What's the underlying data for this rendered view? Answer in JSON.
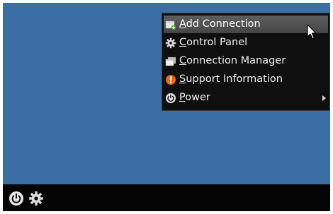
{
  "desktop": {
    "background_color": "#3c6ea6"
  },
  "menu": {
    "items": [
      {
        "label_first": "A",
        "label_rest": "dd Connection",
        "icon": "add-connection-icon",
        "selected": true,
        "has_submenu": false
      },
      {
        "label_first": "C",
        "label_rest": "ontrol Panel",
        "icon": "gear-icon",
        "selected": false,
        "has_submenu": false
      },
      {
        "label_first": "C",
        "label_rest": "onnection Manager",
        "icon": "window-icon",
        "selected": false,
        "has_submenu": false
      },
      {
        "label_first": "S",
        "label_rest": "upport Information",
        "icon": "info-icon",
        "selected": false,
        "has_submenu": false
      },
      {
        "label_first": "P",
        "label_rest": "ower",
        "icon": "power-icon",
        "selected": false,
        "has_submenu": true
      }
    ]
  },
  "taskbar": {
    "power_icon": "power-icon",
    "settings_icon": "gear-icon"
  },
  "colors": {
    "menu_background": "#0f0f10",
    "menu_highlight": "#555555",
    "menu_text": "#f0f0f0",
    "taskbar": "#050505",
    "info_orange": "#e8681e",
    "add_green": "#3fae2a"
  }
}
